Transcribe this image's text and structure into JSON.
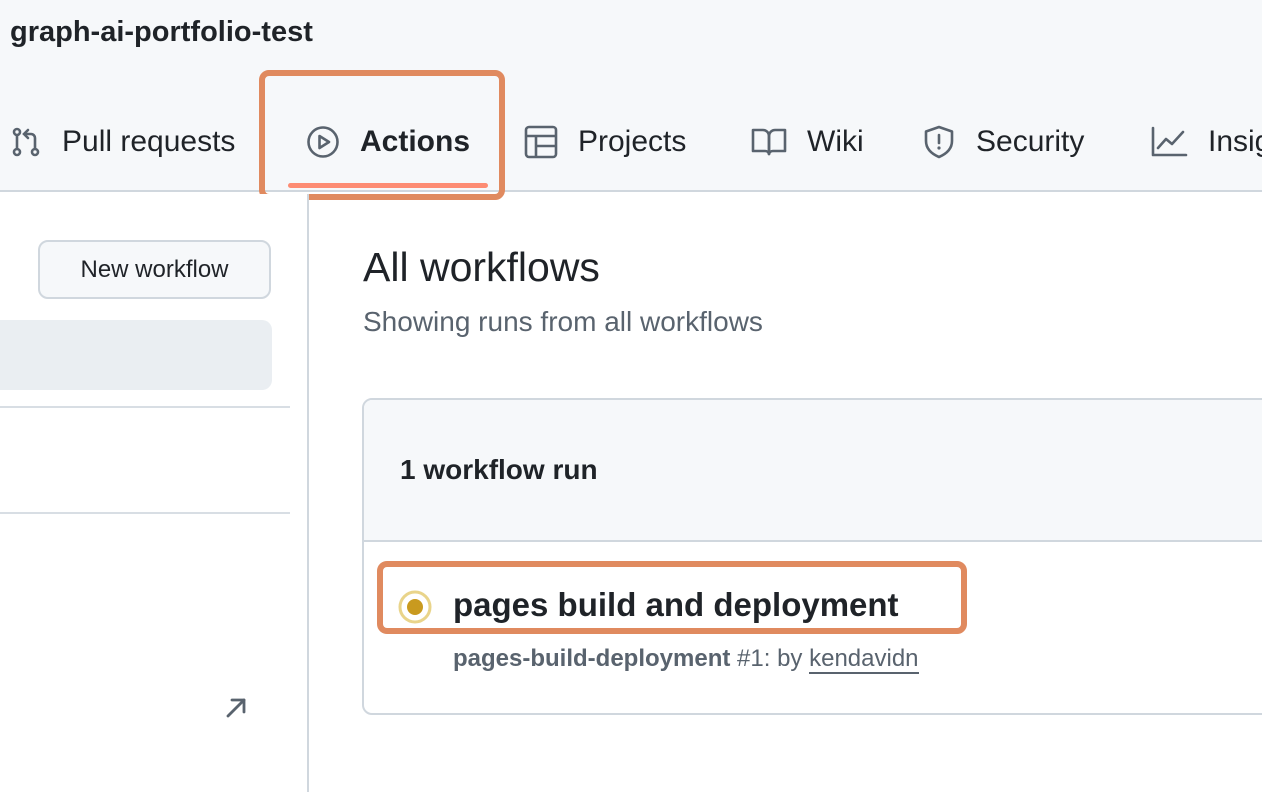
{
  "repo": {
    "title": "graph-ai-portfolio-test"
  },
  "tabs": [
    {
      "label": "Pull requests",
      "icon": "git-pull-request-icon"
    },
    {
      "label": "Actions",
      "icon": "play-icon",
      "active": true
    },
    {
      "label": "Projects",
      "icon": "table-icon"
    },
    {
      "label": "Wiki",
      "icon": "book-icon"
    },
    {
      "label": "Security",
      "icon": "shield-icon"
    },
    {
      "label": "Insig",
      "icon": "graph-icon"
    }
  ],
  "sidebar": {
    "new_workflow_label": "New workflow",
    "external_link_icon": "arrow-up-right-icon"
  },
  "main": {
    "title": "All workflows",
    "subtitle": "Showing runs from all workflows",
    "runs_count": "1 workflow run",
    "runs": [
      {
        "title": "pages build and deployment",
        "workflow": "pages-build-deployment",
        "run_number": "#1",
        "by_text": ": by",
        "actor": "kendavidn",
        "status": "in-progress",
        "status_icon": "status-in-progress-icon"
      }
    ]
  },
  "colors": {
    "accent_underline": "#fd8c73",
    "highlight_box": "#e08a5f",
    "status_in_progress": "#bf8700"
  }
}
